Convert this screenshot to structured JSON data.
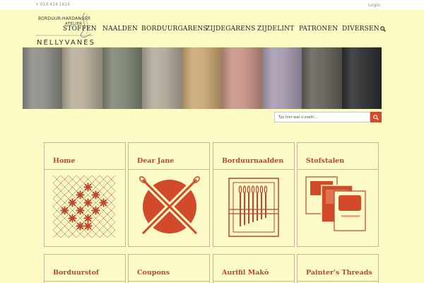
{
  "topbar": {
    "phone": "+ 010 414 1614",
    "login": "Login"
  },
  "logo": {
    "line1": "BORDUUR-HARDANGER",
    "line2": "ATELIER",
    "name": "NELLYVANES"
  },
  "nav": {
    "items": [
      "STOFFEN",
      "NAALDEN",
      "BORDUURGARENS",
      "ZIJDEGARENS",
      "ZIJDELINT",
      "PATRONEN",
      "DIVERSEN"
    ]
  },
  "banner": {
    "fabric_colors": [
      "#8d8c86",
      "#b7ad98",
      "#7f8576",
      "#b2a99a",
      "#c9a774",
      "#c89486",
      "#a59ab0",
      "#636158",
      "#2d2e30"
    ]
  },
  "search": {
    "placeholder": "Typ hier wat u zoekt..."
  },
  "cards": [
    {
      "title": "Home",
      "icon": "cross-stitch-icon"
    },
    {
      "title": "Dear Jane",
      "icon": "crossed-needles-icon"
    },
    {
      "title": "Borduurnaalden",
      "icon": "needles-icon"
    },
    {
      "title": "Stofstalen",
      "icon": "fabric-swatches-icon"
    },
    {
      "title": "Borduurstof",
      "icon": ""
    },
    {
      "title": "Coupons",
      "icon": ""
    },
    {
      "title": "Aurifil Makò",
      "icon": ""
    },
    {
      "title": "Painter's Threads",
      "icon": ""
    }
  ],
  "colors": {
    "accent": "#c0452a",
    "background": "#fdfbc4",
    "card_border": "#c9b39a"
  }
}
